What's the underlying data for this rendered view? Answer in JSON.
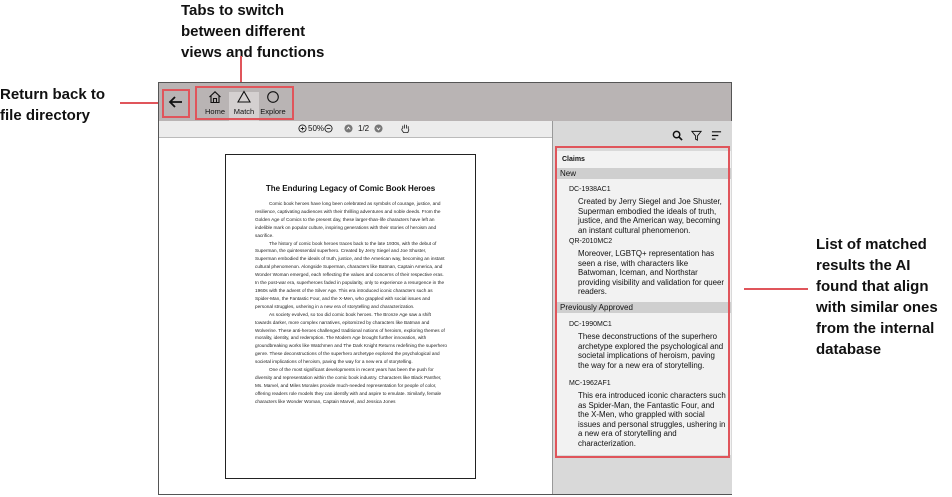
{
  "annotations": {
    "tabs_note": "Tabs to switch\nbetween different\nviews and functions",
    "back_note": "Return back to\nfile directory",
    "results_note": "List of matched\nresults the AI\nfound that align\nwith similar ones\nfrom the internal\ndatabase"
  },
  "colors": {
    "annotation_red": "#e0555b",
    "topbar": "#b9b4b4",
    "panel": "#d9d9d9"
  },
  "nav": {
    "back_icon": "arrow-left-icon",
    "tabs": [
      {
        "label": "Home",
        "icon": "home-icon"
      },
      {
        "label": "Match",
        "icon": "triangle-icon",
        "active": true
      },
      {
        "label": "Explore",
        "icon": "circle-icon"
      }
    ]
  },
  "viewer": {
    "zoom": "50%",
    "page_indicator": "1/2",
    "icons": [
      "zoom-in-icon",
      "zoom-out-icon",
      "page-up-icon",
      "page-down-icon",
      "hand-icon"
    ]
  },
  "document": {
    "title": "The Enduring Legacy of Comic Book Heroes",
    "paragraphs": [
      "Comic book heroes have long been celebrated as symbols of courage, justice, and resilience, captivating audiences with their thrilling adventures and noble deeds. From the Golden Age of Comics to the present day, these larger-than-life characters have left an indelible mark on popular culture, inspiring generations with their stories of heroism and sacrifice.",
      "The history of comic book heroes traces back to the late 1930s, with the debut of Superman, the quintessential superhero. Created by Jerry Siegel and Joe Shuster, Superman embodied the ideals of truth, justice, and the American way, becoming an instant cultural phenomenon. Alongside Superman, characters like Batman, Captain America, and Wonder Woman emerged, each reflecting the values and concerns of their respective eras. In the post-war era, superheroes faded in popularity, only to experience a resurgence in the 1960s with the advent of the Silver Age. This era introduced iconic characters such as Spider-Man, the Fantastic Four, and the X-Men, who grappled with social issues and personal struggles, ushering in a new era of storytelling and characterization.",
      "As society evolved, so too did comic book heroes. The Bronze Age saw a shift towards darker, more complex narratives, epitomized by characters like Batman and Wolverine. These anti-heroes challenged traditional notions of heroism, exploring themes of morality, identity, and redemption. The Modern Age brought further innovation, with groundbreaking works like Watchmen and The Dark Knight Returns redefining the superhero genre. These deconstructions of the superhero archetype explored the psychological and societal implications of heroism, paving the way for a new era of storytelling.",
      "One of the most significant developments in recent years has been the push for diversity and representation within the comic book industry. Characters like Black Panther, Ms. Marvel, and Miles Morales provide much-needed representation for people of color, offering readers role models they can identify with and aspire to emulate. Similarly, female characters like Wonder Woman, Captain Marvel, and Jessica Jones"
    ]
  },
  "claims": {
    "title": "Claims",
    "sections": [
      {
        "heading": "New",
        "items": [
          {
            "id": "DC-1938AC1",
            "text": "Created by Jerry Siegel and Joe Shuster, Superman embodied the ideals of truth, justice, and the American way, becoming an instant cultural phenomenon."
          },
          {
            "id": "QR-2010MC2",
            "text": "Moreover, LGBTQ+ representation has seen a rise, with characters like Batwoman, Iceman, and Northstar providing visibility and validation for queer readers."
          }
        ]
      },
      {
        "heading": "Previously Approved",
        "items": [
          {
            "id": "DC-1990MC1",
            "text": "These deconstructions of the superhero archetype explored the psychological and societal implications of heroism, paving the way for a new era of storytelling."
          },
          {
            "id": "MC-1962AF1",
            "text": "This era introduced iconic characters such as Spider-Man, the Fantastic Four, and the X-Men, who grappled with social issues and personal struggles, ushering in a new era of storytelling and characterization."
          }
        ]
      }
    ],
    "toolbar_icons": [
      "search-icon",
      "filter-icon",
      "sort-icon"
    ]
  }
}
